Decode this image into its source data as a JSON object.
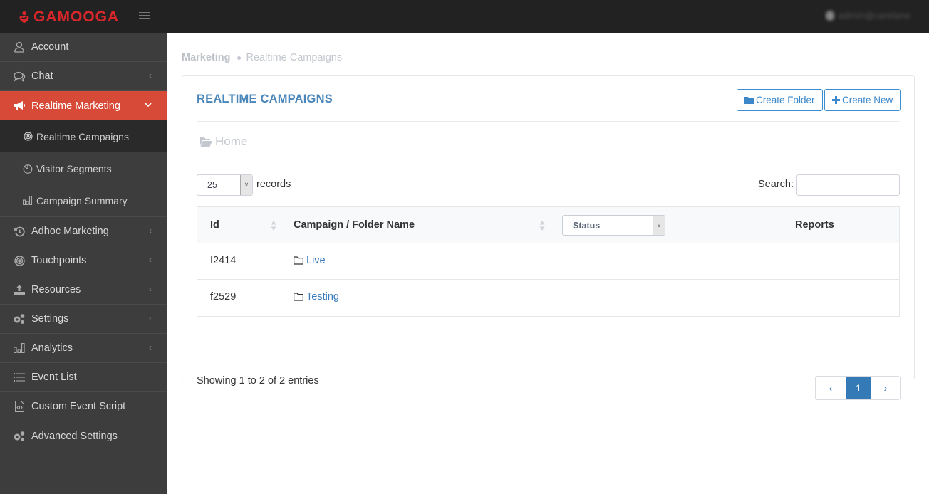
{
  "topbar": {
    "brand": "GAMOOGA",
    "user_label": "admin@carelane"
  },
  "sidebar": {
    "items": [
      {
        "label": "Account",
        "icon": "user-icon",
        "has_chevron": false
      },
      {
        "label": "Chat",
        "icon": "chat-icon",
        "has_chevron": true
      },
      {
        "label": "Realtime Marketing",
        "icon": "megaphone-icon",
        "has_chevron": true,
        "active": true,
        "children": [
          {
            "label": "Realtime Campaigns",
            "icon": "target-icon",
            "active": true
          },
          {
            "label": "Visitor Segments",
            "icon": "pie-chart-icon"
          },
          {
            "label": "Campaign Summary",
            "icon": "bar-chart-icon"
          }
        ]
      },
      {
        "label": "Adhoc Marketing",
        "icon": "history-icon",
        "has_chevron": true
      },
      {
        "label": "Touchpoints",
        "icon": "target-icon",
        "has_chevron": true
      },
      {
        "label": "Resources",
        "icon": "upload-icon",
        "has_chevron": true
      },
      {
        "label": "Settings",
        "icon": "gears-icon",
        "has_chevron": true
      },
      {
        "label": "Analytics",
        "icon": "bar-chart-icon",
        "has_chevron": true
      },
      {
        "label": "Event List",
        "icon": "list-icon",
        "has_chevron": false
      },
      {
        "label": "Custom Event Script",
        "icon": "code-file-icon",
        "has_chevron": false
      },
      {
        "label": "Advanced Settings",
        "icon": "gears-icon",
        "has_chevron": false
      }
    ]
  },
  "breadcrumb": {
    "root": "Marketing",
    "current": "Realtime Campaigns"
  },
  "card": {
    "title": "REALTIME CAMPAIGNS",
    "create_folder_label": "Create Folder",
    "create_new_label": "Create New",
    "folder_path": "Home"
  },
  "table_controls": {
    "page_length": "25",
    "records_label": "records",
    "search_label": "Search:",
    "search_value": ""
  },
  "table": {
    "columns": [
      "Id",
      "Campaign / Folder Name",
      "Status",
      "Reports"
    ],
    "status_filter": "Status",
    "rows": [
      {
        "id": "f2414",
        "name": "Live",
        "type": "folder"
      },
      {
        "id": "f2529",
        "name": "Testing",
        "type": "folder"
      }
    ]
  },
  "footer": {
    "info": "Showing 1 to 2 of 2 entries",
    "prev": "‹",
    "current_page": "1",
    "next": "›"
  },
  "colors": {
    "brand": "#d9262b",
    "active_nav": "#d84a38",
    "title": "#4a86b9",
    "link": "#3b7dbd",
    "page_active": "#337ab7"
  }
}
